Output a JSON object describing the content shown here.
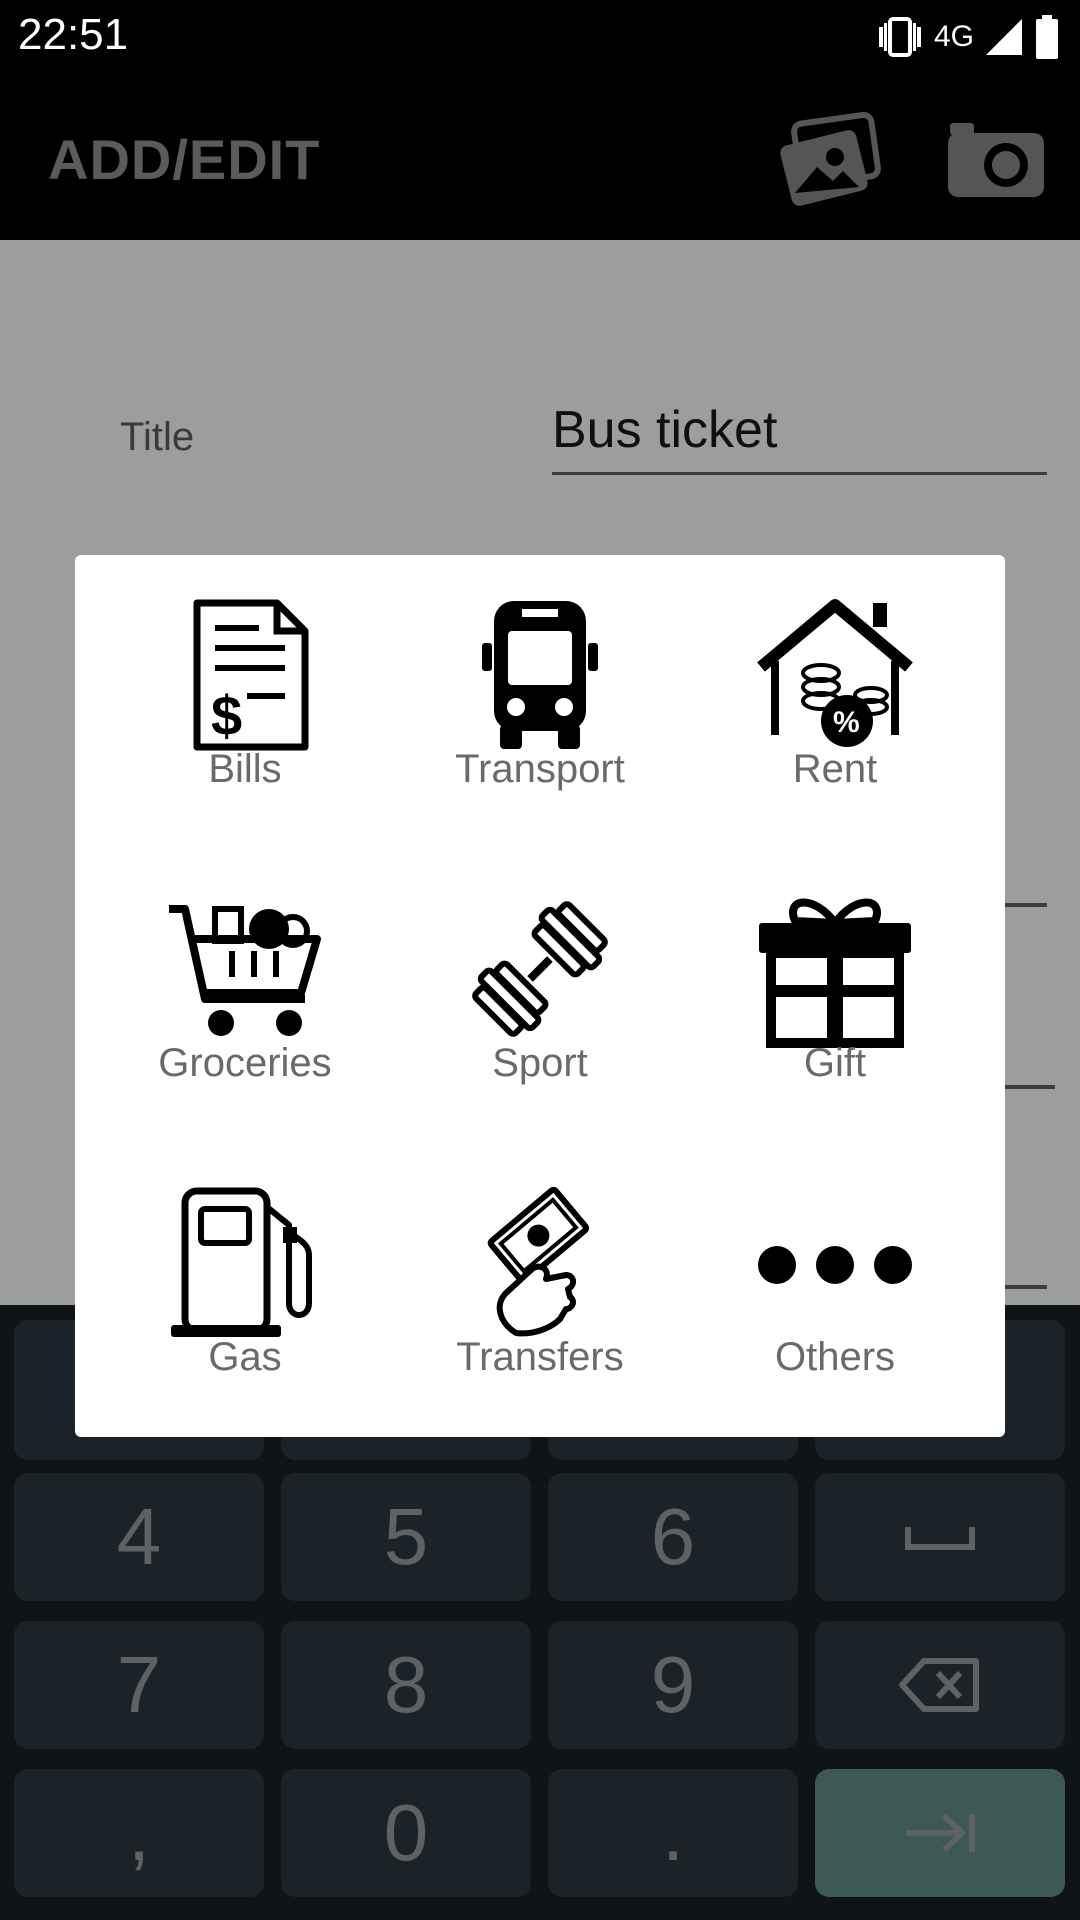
{
  "status_bar": {
    "time": "22:51",
    "network": "4G"
  },
  "app_bar": {
    "title": "ADD/EDIT",
    "icons": [
      "gallery-icon",
      "camera-icon"
    ]
  },
  "form": {
    "title_label": "Title",
    "title_value": "Bus ticket"
  },
  "category_dialog": {
    "items": [
      {
        "label": "Bills",
        "icon": "bill-icon"
      },
      {
        "label": "Transport",
        "icon": "bus-icon"
      },
      {
        "label": "Rent",
        "icon": "house-coins-icon"
      },
      {
        "label": "Groceries",
        "icon": "shopping-cart-icon"
      },
      {
        "label": "Sport",
        "icon": "dumbbell-icon"
      },
      {
        "label": "Gift",
        "icon": "gift-icon"
      },
      {
        "label": "Gas",
        "icon": "gas-pump-icon"
      },
      {
        "label": "Transfers",
        "icon": "hand-money-icon"
      },
      {
        "label": "Others",
        "icon": "more-dots-icon"
      }
    ]
  },
  "keypad": {
    "keys": [
      "4",
      "5",
      "6",
      "7",
      "8",
      "9",
      ",",
      "0",
      "."
    ],
    "special_icons": [
      "space-icon",
      "backspace-icon",
      "enter-icon"
    ],
    "enter_color": "#3d5954"
  }
}
